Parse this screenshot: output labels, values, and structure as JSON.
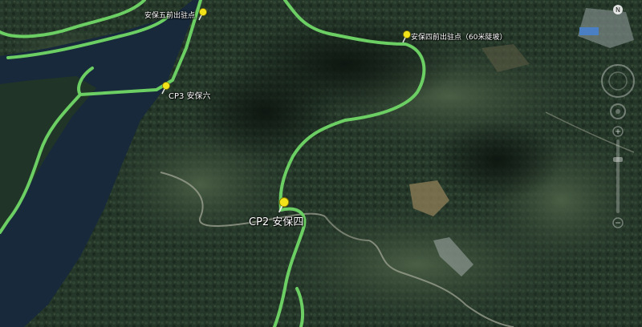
{
  "map": {
    "type": "satellite-3d-terrain",
    "route_color": "#6ccf63",
    "water_color": "#1a2e3a",
    "forest_color": "#2a3e2f",
    "placemark_color": "#f2e21a"
  },
  "placemarks": [
    {
      "id": "cp2",
      "label": "CP2 安保四",
      "icon": "pushpin-icon"
    },
    {
      "id": "cp3",
      "label": "CP3 安保六",
      "icon": "pushpin-icon"
    },
    {
      "id": "front-station-4",
      "label": "安保四前出驻点（60米陡坡）",
      "icon": "pushpin-icon"
    },
    {
      "id": "front-station-5",
      "label": "安保五前出驻点",
      "icon": "pushpin-icon"
    }
  ],
  "navigation": {
    "compass_label": "N",
    "controls": [
      "look-ring-icon",
      "move-ring-icon",
      "zoom-slider-icon"
    ]
  }
}
